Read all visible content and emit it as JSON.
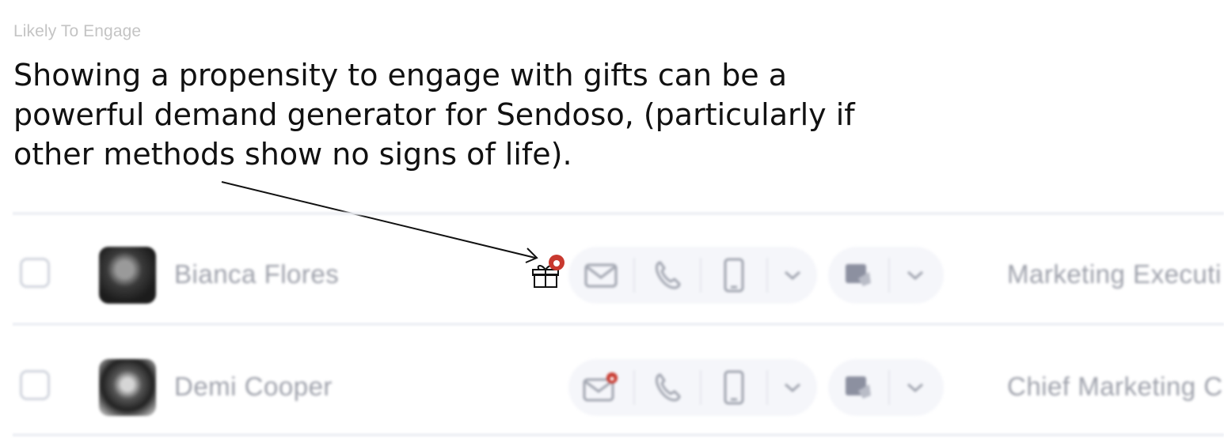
{
  "section_label": "Likely To Engage",
  "annotation_text": "Showing a propensity to engage with gifts can be a powerful demand generator for Sendoso, (particularly if other methods show no signs of life).",
  "rows": [
    {
      "name": "Bianca Flores",
      "title": "Marketing Executi",
      "gift_indicator": "gift-icon",
      "email_badge": false
    },
    {
      "name": "Demi Cooper",
      "title": "Chief Marketing C",
      "gift_indicator": null,
      "email_badge": true
    }
  ],
  "action_icons": [
    "email-icon",
    "phone-icon",
    "mobile-icon",
    "chevron-down-icon"
  ],
  "social_icons": [
    "linkedin-message-icon",
    "chevron-down-icon"
  ],
  "colors": {
    "badge": "#c8392f",
    "pill_bg": "#f5f6fa",
    "muted_text": "#9da0aa"
  }
}
